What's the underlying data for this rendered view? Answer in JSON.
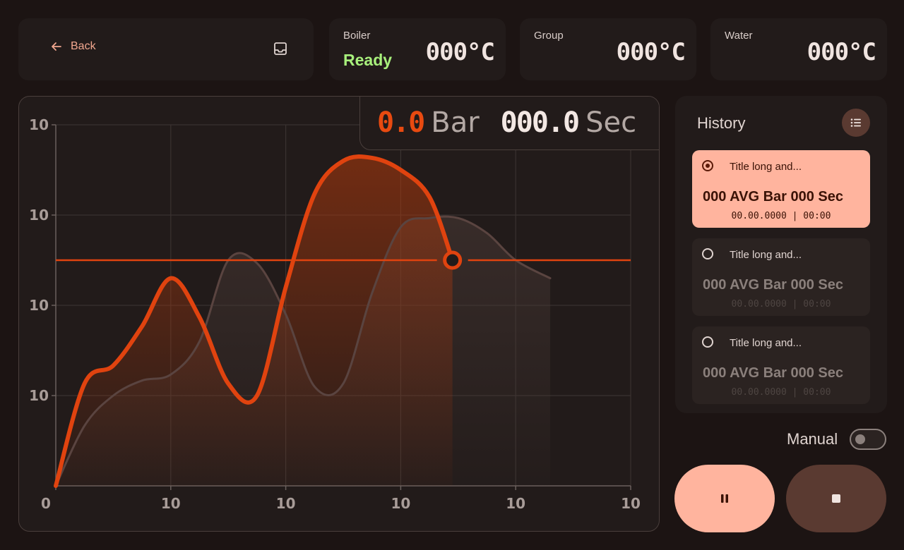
{
  "header": {
    "back_label": "Back"
  },
  "temps": {
    "boiler": {
      "label": "Boiler",
      "status": "Ready",
      "value": "000°C"
    },
    "group": {
      "label": "Group",
      "value": "000°C"
    },
    "water": {
      "label": "Water",
      "value": "000°C"
    }
  },
  "readout": {
    "pressure": "0.0",
    "pressure_unit": "Bar",
    "time": "000.0",
    "time_unit": "Sec"
  },
  "chart_data": {
    "type": "line",
    "xlabel": "",
    "ylabel": "",
    "x_ticks": [
      "0",
      "10",
      "10",
      "10",
      "10",
      "10"
    ],
    "y_ticks": [
      "10",
      "10",
      "10",
      "10"
    ],
    "grid": true,
    "colors": {
      "live": "#e0430f",
      "reference": "#5a4440",
      "target_line": "#e0430f"
    },
    "series": [
      {
        "role": "live",
        "x": [
          0,
          0.5,
          1.0,
          1.5,
          2.0,
          2.5,
          3.0,
          3.5,
          4.0,
          4.5,
          5.0,
          5.5,
          6.0,
          6.5,
          6.9
        ],
        "y": [
          0,
          3.4,
          4.0,
          5.3,
          6.9,
          5.6,
          3.4,
          3.0,
          6.6,
          9.7,
          10.8,
          10.9,
          10.5,
          9.6,
          7.5
        ]
      },
      {
        "role": "reference",
        "x": [
          0,
          0.5,
          1.0,
          1.5,
          2.0,
          2.5,
          3.0,
          3.5,
          4.0,
          4.5,
          5.0,
          5.5,
          6.0,
          6.5,
          7.0,
          7.5,
          8.0,
          8.6
        ],
        "y": [
          0,
          2.0,
          3.0,
          3.5,
          3.7,
          4.8,
          7.5,
          7.4,
          5.7,
          3.3,
          3.4,
          6.4,
          8.6,
          8.9,
          8.9,
          8.4,
          7.5,
          6.9
        ]
      }
    ],
    "target_y": 7.5,
    "cursor": {
      "x": 6.9,
      "y": 7.5
    }
  },
  "history": {
    "title": "History",
    "items": [
      {
        "title": "Title long and...",
        "stats": "000 AVG Bar  000 Sec",
        "date": "00.00.0000 | 00:00",
        "selected": true
      },
      {
        "title": "Title long and...",
        "stats": "000 AVG Bar  000 Sec",
        "date": "00.00.0000 | 00:00",
        "selected": false
      },
      {
        "title": "Title long and...",
        "stats": "000 AVG Bar  000 Sec",
        "date": "00.00.0000 | 00:00",
        "selected": false
      }
    ]
  },
  "controls": {
    "manual_label": "Manual",
    "manual_on": false,
    "pause_icon": "pause-icon",
    "stop_icon": "stop-icon"
  }
}
